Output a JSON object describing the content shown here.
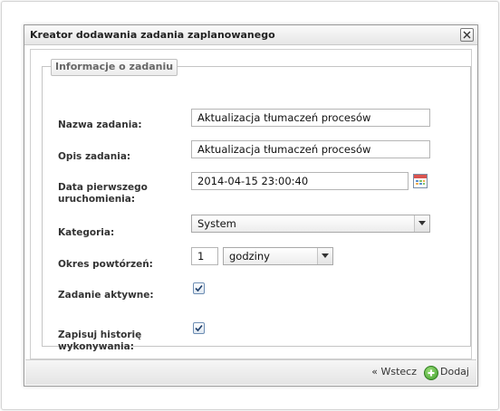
{
  "dialog": {
    "title": "Kreator dodawania zadania zaplanowanego",
    "close_icon": "close-icon"
  },
  "form": {
    "legend": "Informacje o zadaniu",
    "task_name_label": "Nazwa zadania:",
    "task_name_value": "Aktualizacja tłumaczeń procesów",
    "description_label": "Opis zadania:",
    "description_value": "Aktualizacja tłumaczeń procesów",
    "first_run_label": "Data pierwszego uruchomienia:",
    "first_run_value": "2014-04-15 23:00:40",
    "calendar_icon": "calendar-icon",
    "category_label": "Kategoria:",
    "category_value": "System",
    "repeat_label": "Okres powtórzeń:",
    "repeat_count": "1",
    "repeat_unit": "godziny",
    "active_label": "Zadanie aktywne:",
    "active_checked": true,
    "history_label": "Zapisuj historię wykonywania:",
    "history_checked": true
  },
  "footer": {
    "back_label": "« Wstecz",
    "add_label": "Dodaj",
    "add_icon": "plus-icon"
  },
  "colors": {
    "accent_green": "#3f9b2a",
    "checkbox_border": "#6c8db3"
  }
}
